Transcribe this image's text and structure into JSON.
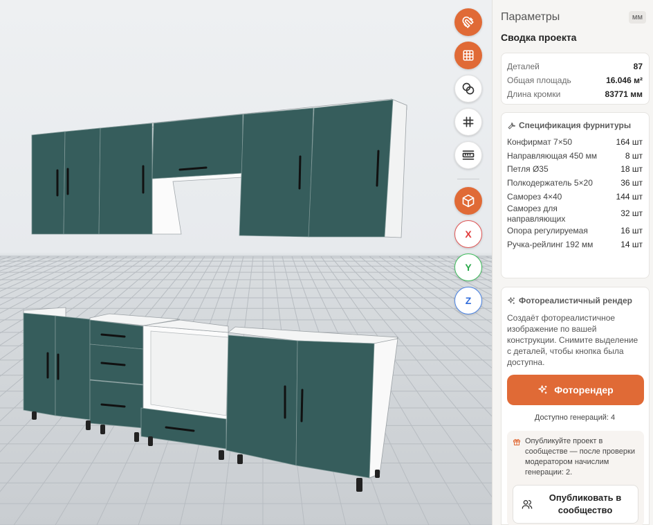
{
  "viewport": {
    "toolbar": [
      {
        "name": "magnet-tool-button",
        "icon": "magnet-icon",
        "style": "orange"
      },
      {
        "name": "grid-tool-button",
        "icon": "grid-icon",
        "style": "orange"
      },
      {
        "name": "intersect-tool-button",
        "icon": "intersect-circles-icon",
        "style": "white"
      },
      {
        "name": "hash-grid-tool-button",
        "icon": "hash-icon",
        "style": "white"
      },
      {
        "name": "ruler-tool-button",
        "icon": "ruler-icon",
        "style": "white"
      },
      {
        "name": "cube-view-button",
        "icon": "cube-icon",
        "style": "orange"
      }
    ],
    "axes": {
      "x": "X",
      "y": "Y",
      "z": "Z"
    }
  },
  "panel": {
    "title": "Параметры",
    "unit": "мм",
    "summary_title": "Сводка проекта",
    "summary": [
      {
        "label": "Деталей",
        "value": "87"
      },
      {
        "label": "Общая площадь",
        "value": "16.046 м²"
      },
      {
        "label": "Длина кромки",
        "value": "83771 мм"
      }
    ],
    "hardware": {
      "title": "Спецификация фурнитуры",
      "icon": "wrench-icon",
      "items": [
        {
          "name": "Конфирмат 7×50",
          "qty": "164 шт"
        },
        {
          "name": "Направляющая 450 мм",
          "qty": "8 шт"
        },
        {
          "name": "Петля Ø35",
          "qty": "18 шт"
        },
        {
          "name": "Полкодержатель 5×20",
          "qty": "36 шт"
        },
        {
          "name": "Саморез 4×40",
          "qty": "144 шт"
        },
        {
          "name": "Саморез для направляющих",
          "qty": "32 шт"
        },
        {
          "name": "Опора регулируемая",
          "qty": "16 шт"
        },
        {
          "name": "Ручка-рейлинг 192 мм",
          "qty": "14 шт"
        }
      ]
    },
    "render": {
      "title": "Фотореалистичный рендер",
      "icon": "sparkles-icon",
      "description": "Создаёт фотореалистичное изображение по вашей конструкции. Снимите выделение с деталей, чтобы кнопка была доступна.",
      "button_label": "Фоторендер",
      "generations": "Доступно генераций: 4",
      "publish_text": "Опубликуйте проект в сообществе — после проверки модератором начислим генерации: 2.",
      "publish_button": "Опубликовать в сообщество"
    }
  },
  "colors": {
    "accent": "#e06a36",
    "facade": "#365d5c",
    "carcass": "#f7f7f7"
  }
}
